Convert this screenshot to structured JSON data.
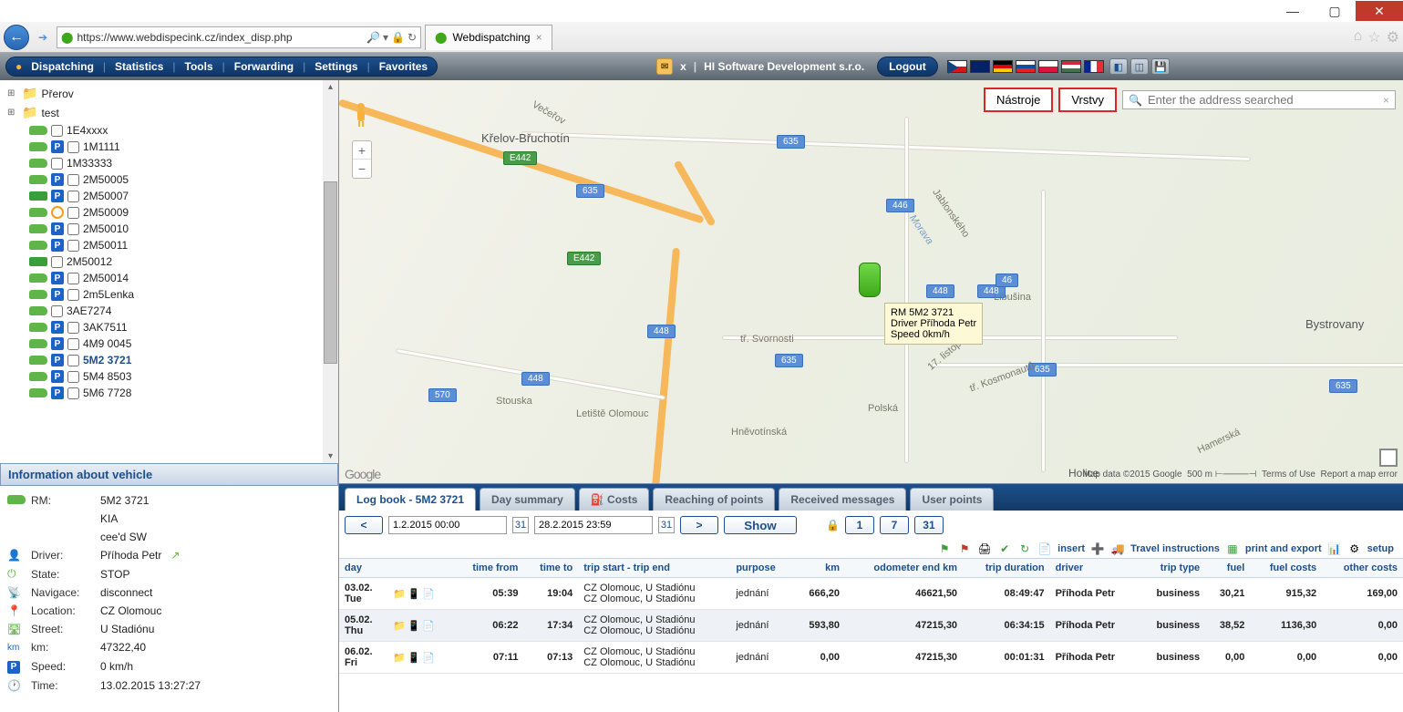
{
  "browser": {
    "url": "https://www.webdispecink.cz/index_disp.php",
    "tab_title": "Webdispatching",
    "search_hint": "Enter the address searched"
  },
  "menu": {
    "items": [
      "Dispatching",
      "Statistics",
      "Tools",
      "Forwarding",
      "Settings",
      "Favorites"
    ],
    "user_prefix": "x",
    "company": "HI Software Development s.r.o.",
    "logout": "Logout"
  },
  "tree": {
    "folders": [
      {
        "name": "Přerov"
      },
      {
        "name": "test"
      }
    ],
    "vehicles": [
      {
        "id": "1E4xxxx",
        "p": false
      },
      {
        "id": "1M1111",
        "p": true
      },
      {
        "id": "1M33333",
        "p": false
      },
      {
        "id": "2M50005",
        "p": true
      },
      {
        "id": "2M50007",
        "p": true,
        "type": "bus"
      },
      {
        "id": "2M50009",
        "p": false,
        "type": "tractor",
        "o": true
      },
      {
        "id": "2M50010",
        "p": true
      },
      {
        "id": "2M50011",
        "p": true
      },
      {
        "id": "2M50012",
        "p": false,
        "type": "bus"
      },
      {
        "id": "2M50014",
        "p": true,
        "type": "tractor"
      },
      {
        "id": "2m5Lenka",
        "p": true
      },
      {
        "id": "3AE7274",
        "p": false
      },
      {
        "id": "3AK7511",
        "p": true
      },
      {
        "id": "4M9 0045",
        "p": true
      },
      {
        "id": "5M2 3721",
        "p": true,
        "selected": true
      },
      {
        "id": "5M4 8503",
        "p": true
      },
      {
        "id": "5M6 7728",
        "p": true
      }
    ]
  },
  "info": {
    "header": "Information about vehicle",
    "rows": {
      "rm_label": "RM:",
      "rm": "5M2 3721",
      "model1": "KIA",
      "model2": "cee'd SW",
      "driver_label": "Driver:",
      "driver": "Příhoda Petr",
      "state_label": "State:",
      "state": "STOP",
      "nav_label": "Navigace:",
      "nav": "disconnect",
      "loc_label": "Location:",
      "loc": "CZ Olomouc",
      "street_label": "Street:",
      "street": "U Stadiónu",
      "km_label": "km:",
      "km": "47322,40",
      "speed_label": "Speed:",
      "speed": "0 km/h",
      "time_label": "Time:",
      "time": "13.02.2015 13:27:27"
    }
  },
  "map": {
    "tools_btn": "Nástroje",
    "layers_btn": "Vrstvy",
    "tooltip": {
      "l1": "RM 5M2 3721",
      "l2": "Driver Příhoda Petr",
      "l3": "Speed 0km/h"
    },
    "places": {
      "krelov": "Křelov-Břuchotín",
      "letiste": "Letiště Olomouc",
      "hnevo": "Hněvotínská",
      "svornosti": "tř. Svornosti",
      "stouska": "Stouska",
      "kosmo": "tř. Kosmonautů",
      "polska": "Polská",
      "listopad": "17. listopadu",
      "jablon": "Jablonského",
      "morava": "Morava",
      "libusina": "Libušina",
      "bystrovany": "Bystrovany",
      "hamerska": "Hamerská",
      "holice": "Holice",
      "vecerov": "Večeřov"
    },
    "pills": {
      "e442a": "E442",
      "e442b": "E442",
      "r635a": "635",
      "r635b": "635",
      "r635c": "635",
      "r635d": "635",
      "r635e": "635",
      "r448a": "448",
      "r448b": "448",
      "r448c": "448",
      "r448d": "448",
      "r446": "446",
      "r46": "46",
      "r570": "570"
    },
    "footer": {
      "google": "Google",
      "data": "Map data ©2015 Google",
      "scale": "500 m",
      "terms": "Terms of Use",
      "report": "Report a map error"
    }
  },
  "tabs": {
    "logbook": "Log book - 5M2 3721",
    "day": "Day summary",
    "costs": "Costs",
    "reaching": "Reaching of points",
    "received": "Received messages",
    "userpts": "User points"
  },
  "filter": {
    "from": "1.2.2015 00:00",
    "to": "28.2.2015 23:59",
    "show": "Show",
    "one": "1",
    "seven": "7",
    "thirtyone": "31"
  },
  "actions": {
    "insert": "insert",
    "travel": "Travel instructions",
    "print": "print and export",
    "setup": "setup"
  },
  "table": {
    "headers": {
      "day": "day",
      "tfrom": "time from",
      "tto": "time to",
      "trip": "trip start - trip end",
      "purpose": "purpose",
      "km": "km",
      "odo": "odometer end km",
      "dur": "trip duration",
      "driver": "driver",
      "ttype": "trip type",
      "fuel": "fuel",
      "fcosts": "fuel costs",
      "ocosts": "other costs"
    },
    "rows": [
      {
        "day": "03.02. Tue",
        "tfrom": "05:39",
        "tto": "19:04",
        "trip1": "CZ Olomouc, U Stadiónu",
        "trip2": "CZ Olomouc, U Stadiónu",
        "purpose": "jednání",
        "km": "666,20",
        "odo": "46621,50",
        "dur": "08:49:47",
        "driver": "Příhoda Petr",
        "ttype": "business",
        "fuel": "30,21",
        "fcosts": "915,32",
        "ocosts": "169,00"
      },
      {
        "day": "05.02. Thu",
        "tfrom": "06:22",
        "tto": "17:34",
        "trip1": "CZ Olomouc, U Stadiónu",
        "trip2": "CZ Olomouc, U Stadiónu",
        "purpose": "jednání",
        "km": "593,80",
        "odo": "47215,30",
        "dur": "06:34:15",
        "driver": "Příhoda Petr",
        "ttype": "business",
        "fuel": "38,52",
        "fcosts": "1136,30",
        "ocosts": "0,00"
      },
      {
        "day": "06.02. Fri",
        "tfrom": "07:11",
        "tto": "07:13",
        "trip1": "CZ Olomouc, U Stadiónu",
        "trip2": "CZ Olomouc, U Stadiónu",
        "purpose": "jednání",
        "km": "0,00",
        "odo": "47215,30",
        "dur": "00:01:31",
        "driver": "Příhoda Petr",
        "ttype": "business",
        "fuel": "0,00",
        "fcosts": "0,00",
        "ocosts": "0,00"
      }
    ]
  }
}
